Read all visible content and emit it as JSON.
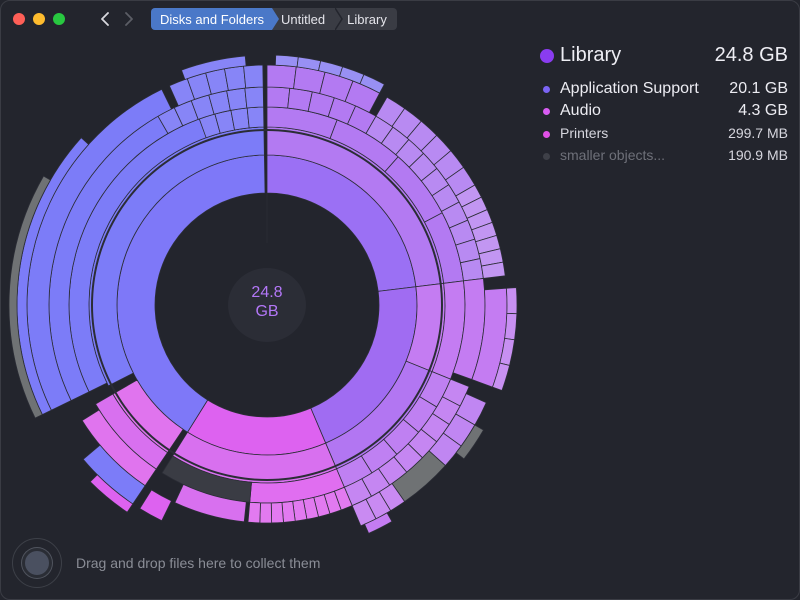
{
  "window": {
    "traffic_lights": [
      "close",
      "minimize",
      "zoom"
    ]
  },
  "breadcrumb": [
    "Disks and Folders",
    "Untitled",
    "Library"
  ],
  "center": {
    "size_value": "24.8",
    "size_unit": "GB"
  },
  "legend": {
    "title": "Library",
    "total": "24.8 GB",
    "title_color": "#8a3cf0",
    "items": [
      {
        "name": "Application Support",
        "size": "20.1 GB",
        "color": "#7b64f4"
      },
      {
        "name": "Audio",
        "size": "4.3 GB",
        "color": "#d85cf2"
      },
      {
        "name": "Printers",
        "size": "299.7  MB",
        "color": "#e050e6"
      },
      {
        "name": "smaller objects...",
        "size": "190.9  MB",
        "color": "#3e4048"
      }
    ]
  },
  "footer": {
    "drop_hint": "Drag and drop files here to collect them"
  },
  "colors": {
    "background": "#23252d",
    "accent": "#4a78c8"
  }
}
